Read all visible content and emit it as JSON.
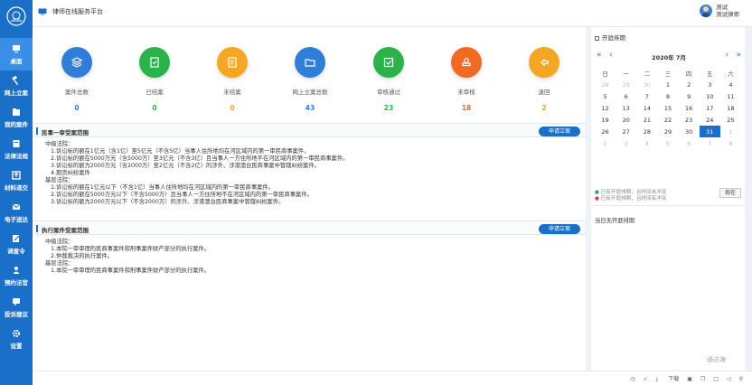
{
  "app": {
    "title": "律师在线服务平台"
  },
  "user": {
    "line1": "测试",
    "line2": "测试律师"
  },
  "nav": [
    {
      "label": "桌面",
      "icon": "monitor-icon"
    },
    {
      "label": "网上立案",
      "icon": "hammer-icon"
    },
    {
      "label": "我的案件",
      "icon": "folder-icon"
    },
    {
      "label": "法律法规",
      "icon": "book-icon"
    },
    {
      "label": "材料递交",
      "icon": "upload-icon"
    },
    {
      "label": "电子送达",
      "icon": "mail-icon"
    },
    {
      "label": "调查令",
      "icon": "edit-icon"
    },
    {
      "label": "预约法官",
      "icon": "person-icon"
    },
    {
      "label": "投诉建议",
      "icon": "chat-icon"
    },
    {
      "label": "设置",
      "icon": "gear-icon"
    }
  ],
  "stats": [
    {
      "label": "案件总数",
      "value": "0",
      "color": "#2f7fd8",
      "valcolor": "#2f7fd8",
      "icon": "layers-icon"
    },
    {
      "label": "已结案",
      "value": "0",
      "color": "#2bb34a",
      "valcolor": "#2bb34a",
      "icon": "document-check-icon"
    },
    {
      "label": "未结案",
      "value": "0",
      "color": "#f5a623",
      "valcolor": "#f5a623",
      "icon": "document-icon"
    },
    {
      "label": "网上立案总数",
      "value": "43",
      "color": "#2f7fd8",
      "valcolor": "#2f7fd8",
      "icon": "folder-icon"
    },
    {
      "label": "审核通过",
      "value": "23",
      "color": "#2bb34a",
      "valcolor": "#2bb34a",
      "icon": "checkbox-icon"
    },
    {
      "label": "未审核",
      "value": "18",
      "color": "#f06a23",
      "valcolor": "#f06a23",
      "icon": "stamp-icon"
    },
    {
      "label": "退回",
      "value": "2",
      "color": "#f5a623",
      "valcolor": "#f5a623",
      "icon": "return-icon"
    }
  ],
  "civil": {
    "title": "民事一审受案范围",
    "button": "申请立案",
    "lines": [
      "中级法院：",
      "1.诉讼标的额在1亿元（含1亿）至5亿元（不含5亿）当事人住所地均在河区域内的第一审民商事案件。",
      "2.诉讼标的额在5000万元（含5000万）至3亿元（不含3亿）且当事人一方住所地不在河区域内的第一审民商事案件。",
      "3.诉讼标的额为2000万元（含2000万）至2亿元（不含2亿）的涉外、涉港澳台民商事案中管辖纠纷案件。",
      "4.期货纠纷案件",
      "基层法院：",
      "1.诉讼标的额在1亿元以下（不含1亿）当事人住所地均在河区域内的第一审民商事案件。",
      "2.诉讼标的额在5000万元以下（不含5000万）且当事人一方住所地不在河区域内的第一审民商事案件。",
      "3.诉讼标的额为2000万元以下（不含2000万）的涉外、涉港澳台民商事案中管辖纠纷案件。"
    ]
  },
  "exec": {
    "title": "执行案件受案范围",
    "button": "申请立案",
    "lines": [
      "中级法院：",
      "1.本院一审审理的民商事案件和刑事案件财产部分的执行案件。",
      "2.仲裁裁决的执行案件。",
      "基层法院：",
      "1.本院一审审理的民商事案件和刑事案件财产部分的执行案件。"
    ]
  },
  "calendar": {
    "heading": "开庭排期",
    "year_month": "2020年 7月",
    "weekdays": [
      "日",
      "一",
      "二",
      "三",
      "四",
      "五",
      "六"
    ],
    "weeks": [
      [
        "28",
        "29",
        "30",
        "1",
        "2",
        "3",
        "4"
      ],
      [
        "5",
        "6",
        "7",
        "8",
        "9",
        "10",
        "11"
      ],
      [
        "12",
        "13",
        "14",
        "15",
        "16",
        "17",
        "18"
      ],
      [
        "19",
        "20",
        "21",
        "22",
        "23",
        "24",
        "25"
      ],
      [
        "26",
        "27",
        "28",
        "29",
        "30",
        "31",
        "1"
      ],
      [
        "2",
        "3",
        "4",
        "5",
        "6",
        "7",
        "8"
      ]
    ],
    "other_month": [
      [
        0,
        0
      ],
      [
        0,
        1
      ],
      [
        0,
        2
      ],
      [
        4,
        6
      ],
      [
        5,
        0
      ],
      [
        5,
        1
      ],
      [
        5,
        2
      ],
      [
        5,
        3
      ],
      [
        5,
        4
      ],
      [
        5,
        5
      ],
      [
        5,
        6
      ]
    ],
    "selected": [
      4,
      5
    ],
    "legend1": "已有开庭排期，且时间未冲突",
    "legend2": "已有开庭排期，且时间有冲突",
    "legend_button": "现在",
    "empty": "当日无开庭排期"
  },
  "bottom": {
    "download": "下载"
  },
  "watermark": "通达海"
}
